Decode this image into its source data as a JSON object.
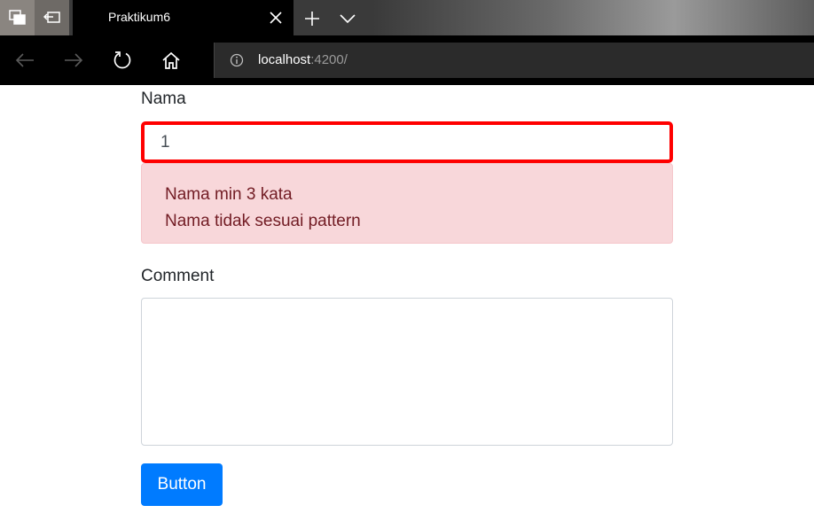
{
  "browser": {
    "tab": {
      "title": "Praktikum6"
    },
    "address": {
      "host": "localhost",
      "port_path": ":4200/"
    }
  },
  "form": {
    "nama": {
      "label": "Nama",
      "value": "1",
      "errors": [
        "Nama min 3 kata",
        "Nama tidak sesuai pattern"
      ]
    },
    "comment": {
      "label": "Comment",
      "value": ""
    },
    "button_label": "Button"
  },
  "colors": {
    "invalid_border": "#ff0000",
    "alert_bg": "#f8d7da",
    "alert_text": "#721c24",
    "primary": "#007bff"
  }
}
